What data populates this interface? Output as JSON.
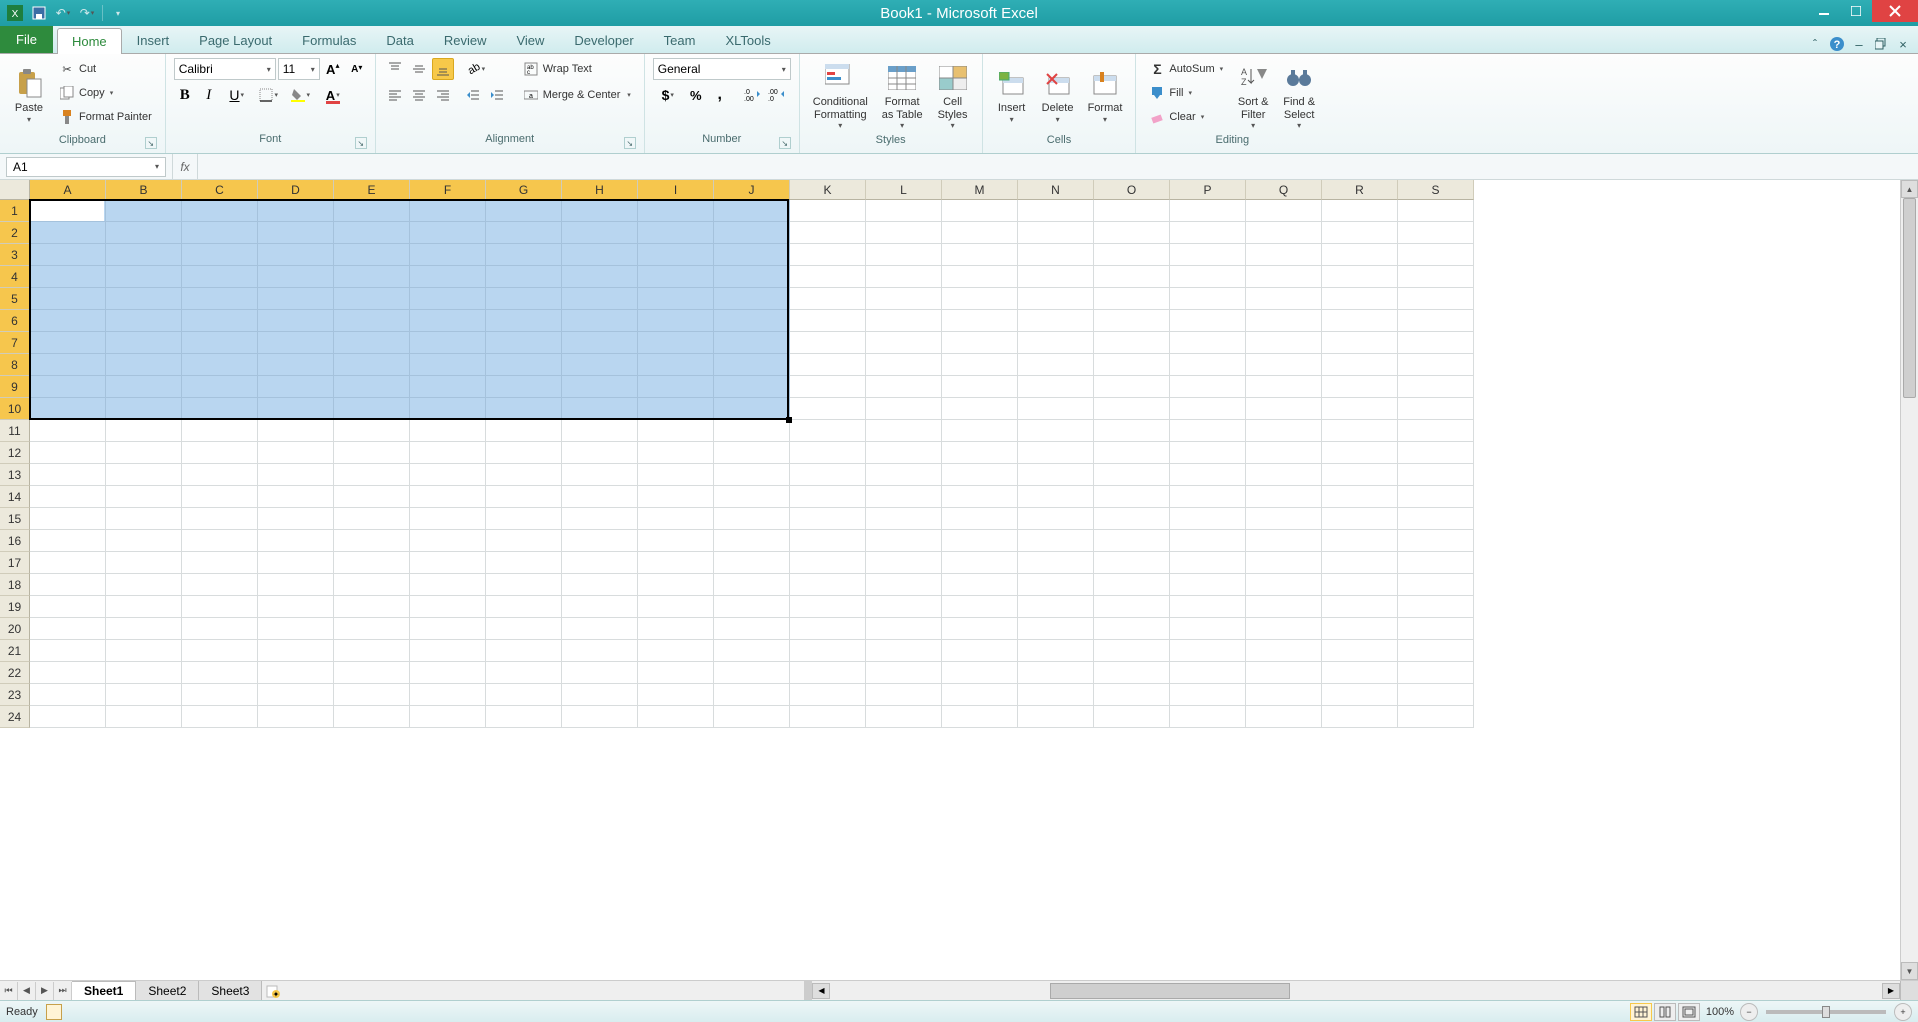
{
  "window": {
    "title": "Book1 - Microsoft Excel"
  },
  "qat": {
    "save": "Save",
    "undo": "Undo",
    "redo": "Redo"
  },
  "tabs": {
    "file": "File",
    "list": [
      "Home",
      "Insert",
      "Page Layout",
      "Formulas",
      "Data",
      "Review",
      "View",
      "Developer",
      "Team",
      "XLTools"
    ],
    "active": "Home"
  },
  "ribbon": {
    "clipboard": {
      "label": "Clipboard",
      "paste": "Paste",
      "cut": "Cut",
      "copy": "Copy",
      "format_painter": "Format Painter"
    },
    "font": {
      "label": "Font",
      "name": "Calibri",
      "size": "11",
      "grow": "Increase Font Size",
      "shrink": "Decrease Font Size"
    },
    "alignment": {
      "label": "Alignment",
      "wrap": "Wrap Text",
      "merge": "Merge & Center"
    },
    "number": {
      "label": "Number",
      "format": "General"
    },
    "styles": {
      "label": "Styles",
      "conditional": "Conditional\nFormatting",
      "as_table": "Format\nas Table",
      "cell_styles": "Cell\nStyles"
    },
    "cells": {
      "label": "Cells",
      "insert": "Insert",
      "delete": "Delete",
      "format": "Format"
    },
    "editing": {
      "label": "Editing",
      "autosum": "AutoSum",
      "fill": "Fill",
      "clear": "Clear",
      "sort": "Sort &\nFilter",
      "find": "Find &\nSelect"
    }
  },
  "formula_bar": {
    "name_box": "A1",
    "formula": ""
  },
  "grid": {
    "columns": [
      "A",
      "B",
      "C",
      "D",
      "E",
      "F",
      "G",
      "H",
      "I",
      "J",
      "K",
      "L",
      "M",
      "N",
      "O",
      "P",
      "Q",
      "R",
      "S"
    ],
    "rows": 24,
    "selected_cols": 10,
    "selected_rows": 10,
    "active_cell": "A1"
  },
  "sheets": {
    "list": [
      "Sheet1",
      "Sheet2",
      "Sheet3"
    ],
    "active": "Sheet1"
  },
  "status": {
    "ready": "Ready",
    "zoom": "100%"
  }
}
